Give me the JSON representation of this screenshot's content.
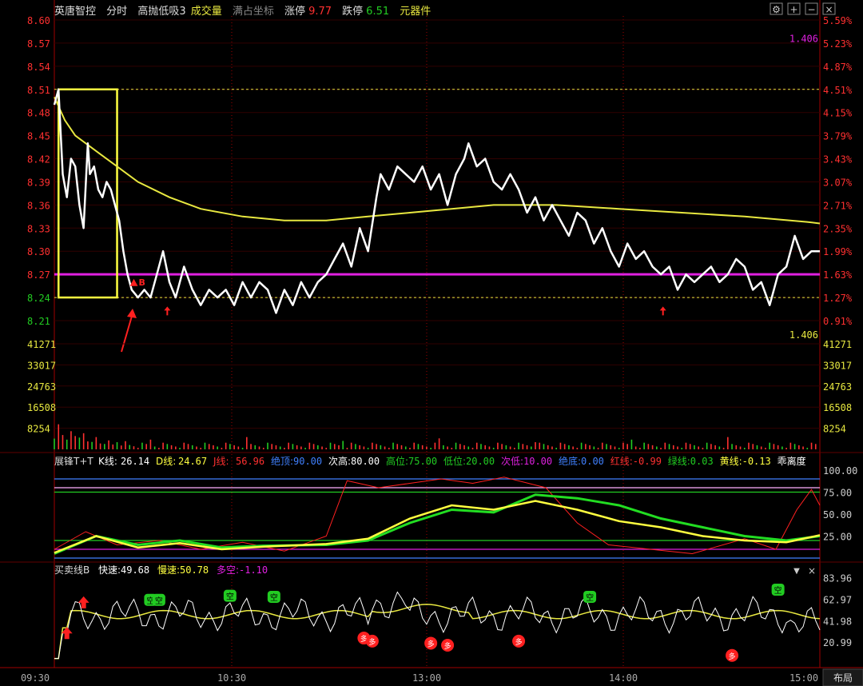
{
  "header": {
    "stock_name": "英唐智控",
    "view": "分时",
    "indicator": "高抛低吸3",
    "volume_label": "成交量",
    "coord_label": "满占坐标",
    "limit_up_label": "涨停",
    "limit_up_value": "9.77",
    "limit_down_label": "跌停",
    "limit_down_value": "6.51",
    "sector": "元器件",
    "icons": [
      "settings-icon",
      "plus-icon",
      "minus-icon",
      "close-icon"
    ]
  },
  "colors": {
    "price_line": "#ffffff",
    "avg_line": "#e8e840",
    "support_line": "#e020e0",
    "box": "#ffff40",
    "up": "#ff2020",
    "down": "#22cc22",
    "grid": "#a00000"
  },
  "chart_data": [
    {
      "type": "line",
      "name": "intraday-price",
      "y_left_ticks": [
        "8.60",
        "8.57",
        "8.54",
        "8.51",
        "8.48",
        "8.45",
        "8.42",
        "8.39",
        "8.36",
        "8.33",
        "8.30",
        "8.27",
        "8.24",
        "8.21"
      ],
      "y_right_ticks": [
        "5.59%",
        "5.23%",
        "4.87%",
        "4.51%",
        "4.15%",
        "3.79%",
        "3.43%",
        "3.07%",
        "2.71%",
        "2.35%",
        "1.99%",
        "1.63%",
        "1.27%",
        "0.91%"
      ],
      "ylim": [
        8.21,
        8.6
      ],
      "x_ticks": [
        "09:30",
        "10:30",
        "13:00",
        "14:00",
        "15:00"
      ],
      "right_labels": [
        "1.406",
        "1.406"
      ],
      "support_level": 8.27,
      "box_range": {
        "price_high": 8.51,
        "price_low": 8.24,
        "time_start": 2,
        "time_end": 30
      },
      "price_points": [
        [
          0,
          8.49
        ],
        [
          2,
          8.51
        ],
        [
          4,
          8.4
        ],
        [
          6,
          8.37
        ],
        [
          8,
          8.42
        ],
        [
          10,
          8.41
        ],
        [
          12,
          8.36
        ],
        [
          14,
          8.33
        ],
        [
          16,
          8.44
        ],
        [
          17,
          8.4
        ],
        [
          19,
          8.41
        ],
        [
          21,
          8.38
        ],
        [
          23,
          8.37
        ],
        [
          25,
          8.39
        ],
        [
          27,
          8.38
        ],
        [
          29,
          8.36
        ],
        [
          31,
          8.34
        ],
        [
          33,
          8.3
        ],
        [
          35,
          8.27
        ],
        [
          37,
          8.25
        ],
        [
          40,
          8.24
        ],
        [
          43,
          8.25
        ],
        [
          46,
          8.24
        ],
        [
          49,
          8.27
        ],
        [
          52,
          8.3
        ],
        [
          55,
          8.26
        ],
        [
          58,
          8.24
        ],
        [
          62,
          8.28
        ],
        [
          66,
          8.25
        ],
        [
          70,
          8.23
        ],
        [
          74,
          8.25
        ],
        [
          78,
          8.24
        ],
        [
          82,
          8.25
        ],
        [
          86,
          8.23
        ],
        [
          90,
          8.26
        ],
        [
          94,
          8.24
        ],
        [
          98,
          8.26
        ],
        [
          102,
          8.25
        ],
        [
          106,
          8.22
        ],
        [
          110,
          8.25
        ],
        [
          114,
          8.23
        ],
        [
          118,
          8.26
        ],
        [
          122,
          8.24
        ],
        [
          126,
          8.26
        ],
        [
          130,
          8.27
        ],
        [
          134,
          8.29
        ],
        [
          138,
          8.31
        ],
        [
          142,
          8.28
        ],
        [
          146,
          8.33
        ],
        [
          150,
          8.3
        ],
        [
          154,
          8.37
        ],
        [
          156,
          8.4
        ],
        [
          160,
          8.38
        ],
        [
          164,
          8.41
        ],
        [
          168,
          8.4
        ],
        [
          172,
          8.39
        ],
        [
          176,
          8.41
        ],
        [
          180,
          8.38
        ],
        [
          184,
          8.4
        ],
        [
          188,
          8.36
        ],
        [
          192,
          8.4
        ],
        [
          196,
          8.42
        ],
        [
          198,
          8.44
        ],
        [
          202,
          8.41
        ],
        [
          206,
          8.42
        ],
        [
          210,
          8.39
        ],
        [
          214,
          8.38
        ],
        [
          218,
          8.4
        ],
        [
          222,
          8.38
        ],
        [
          226,
          8.35
        ],
        [
          230,
          8.37
        ],
        [
          234,
          8.34
        ],
        [
          238,
          8.36
        ],
        [
          242,
          8.34
        ],
        [
          246,
          8.32
        ],
        [
          250,
          8.35
        ],
        [
          254,
          8.34
        ],
        [
          258,
          8.31
        ],
        [
          262,
          8.33
        ],
        [
          266,
          8.3
        ],
        [
          270,
          8.28
        ],
        [
          274,
          8.31
        ],
        [
          278,
          8.29
        ],
        [
          282,
          8.3
        ],
        [
          286,
          8.28
        ],
        [
          290,
          8.27
        ],
        [
          294,
          8.28
        ],
        [
          298,
          8.25
        ],
        [
          302,
          8.27
        ],
        [
          306,
          8.26
        ],
        [
          310,
          8.27
        ],
        [
          314,
          8.28
        ],
        [
          318,
          8.26
        ],
        [
          322,
          8.27
        ],
        [
          326,
          8.29
        ],
        [
          330,
          8.28
        ],
        [
          334,
          8.25
        ],
        [
          338,
          8.26
        ],
        [
          342,
          8.23
        ],
        [
          346,
          8.27
        ],
        [
          350,
          8.28
        ],
        [
          354,
          8.32
        ],
        [
          358,
          8.29
        ],
        [
          362,
          8.3
        ],
        [
          366,
          8.3
        ]
      ],
      "avg_points": [
        [
          0,
          8.5
        ],
        [
          5,
          8.47
        ],
        [
          10,
          8.45
        ],
        [
          20,
          8.43
        ],
        [
          30,
          8.41
        ],
        [
          40,
          8.39
        ],
        [
          55,
          8.37
        ],
        [
          70,
          8.355
        ],
        [
          90,
          8.345
        ],
        [
          110,
          8.34
        ],
        [
          130,
          8.34
        ],
        [
          150,
          8.345
        ],
        [
          170,
          8.35
        ],
        [
          190,
          8.355
        ],
        [
          210,
          8.36
        ],
        [
          240,
          8.36
        ],
        [
          270,
          8.355
        ],
        [
          300,
          8.35
        ],
        [
          330,
          8.345
        ],
        [
          360,
          8.338
        ],
        [
          366,
          8.336
        ]
      ],
      "up_arrows": [
        [
          54,
          8.22
        ],
        [
          291,
          8.22
        ]
      ],
      "buy_marker": {
        "t": 38,
        "price": 8.26,
        "label": "B"
      }
    },
    {
      "type": "bar",
      "name": "volume",
      "y_ticks": [
        "41271",
        "33017",
        "24763",
        "16508",
        "8254"
      ],
      "ylim": [
        0,
        41271
      ],
      "series": [
        {
          "name": "成交量",
          "values": [
            4200,
            9800,
            5600,
            3800,
            7100,
            5200,
            4600,
            6300,
            3100,
            2900,
            4800,
            2300,
            2100,
            3500,
            1900,
            2800,
            1500,
            3200,
            1700,
            1200
          ]
        }
      ]
    },
    {
      "type": "line",
      "name": "kdj-oscillator",
      "title": "展锋T+T",
      "legend": [
        {
          "key": "K线",
          "value": "26.14",
          "color": "#ffffff"
        },
        {
          "key": "D线",
          "value": "24.67",
          "color": "#ffff40"
        },
        {
          "key": "J线",
          "value": "56.96",
          "color": "#ff3030"
        },
        {
          "key": "绝顶",
          "value": "90.00",
          "color": "#4080ff"
        },
        {
          "key": "次高",
          "value": "80.00",
          "color": "#ffffff"
        },
        {
          "key": "高位",
          "value": "75.00",
          "color": "#22cc22"
        },
        {
          "key": "低位",
          "value": "20.00",
          "color": "#22cc22"
        },
        {
          "key": "次低",
          "value": "10.00",
          "color": "#e020e0"
        },
        {
          "key": "绝底",
          "value": "0.00",
          "color": "#4080ff"
        },
        {
          "key": "红线",
          "value": "-0.99",
          "color": "#ff3030"
        },
        {
          "key": "绿线",
          "value": "0.03",
          "color": "#22cc22"
        },
        {
          "key": "黄线",
          "value": "-0.13",
          "color": "#ffff40"
        },
        {
          "key": "乖离度",
          "value": "",
          "color": "#ffffff"
        }
      ],
      "y_ticks": [
        "100.00",
        "75.00",
        "50.00",
        "25.00"
      ],
      "ylim": [
        0,
        100
      ],
      "levels": [
        90,
        80,
        75,
        20,
        10,
        0
      ],
      "green": [
        [
          0,
          5
        ],
        [
          20,
          25
        ],
        [
          40,
          15
        ],
        [
          60,
          20
        ],
        [
          80,
          12
        ],
        [
          100,
          14
        ],
        [
          130,
          15
        ],
        [
          150,
          20
        ],
        [
          170,
          40
        ],
        [
          190,
          55
        ],
        [
          210,
          52
        ],
        [
          230,
          72
        ],
        [
          250,
          68
        ],
        [
          270,
          60
        ],
        [
          290,
          45
        ],
        [
          310,
          35
        ],
        [
          330,
          25
        ],
        [
          350,
          20
        ],
        [
          366,
          25
        ]
      ],
      "yellow": [
        [
          0,
          6
        ],
        [
          20,
          25
        ],
        [
          40,
          12
        ],
        [
          60,
          17
        ],
        [
          80,
          10
        ],
        [
          100,
          13
        ],
        [
          130,
          16
        ],
        [
          150,
          22
        ],
        [
          170,
          45
        ],
        [
          190,
          60
        ],
        [
          210,
          55
        ],
        [
          230,
          65
        ],
        [
          250,
          55
        ],
        [
          270,
          42
        ],
        [
          290,
          35
        ],
        [
          310,
          25
        ],
        [
          330,
          20
        ],
        [
          350,
          18
        ],
        [
          366,
          26
        ]
      ],
      "red": [
        [
          0,
          10
        ],
        [
          15,
          30
        ],
        [
          30,
          15
        ],
        [
          50,
          20
        ],
        [
          70,
          10
        ],
        [
          90,
          18
        ],
        [
          110,
          8
        ],
        [
          130,
          25
        ],
        [
          140,
          88
        ],
        [
          155,
          80
        ],
        [
          170,
          85
        ],
        [
          185,
          90
        ],
        [
          200,
          85
        ],
        [
          215,
          92
        ],
        [
          235,
          80
        ],
        [
          250,
          40
        ],
        [
          265,
          15
        ],
        [
          285,
          10
        ],
        [
          305,
          5
        ],
        [
          330,
          22
        ],
        [
          345,
          10
        ],
        [
          355,
          55
        ],
        [
          362,
          78
        ],
        [
          366,
          60
        ]
      ]
    },
    {
      "type": "line",
      "name": "buy-sell-line",
      "title": "买卖线B",
      "legend": [
        {
          "key": "快速",
          "value": "49.68",
          "color": "#ffffff"
        },
        {
          "key": "慢速",
          "value": "50.78",
          "color": "#ffff40"
        },
        {
          "key": "多空",
          "value": "-1.10",
          "color": "#e020e0"
        }
      ],
      "y_ticks": [
        "83.96",
        "62.97",
        "41.98",
        "20.99"
      ],
      "ylim": [
        0,
        90
      ],
      "markers_kong": [
        "空",
        "空",
        "空",
        "空",
        "空",
        "空"
      ],
      "markers_duo": [
        "多",
        "多",
        "多",
        "多",
        "多",
        "多"
      ],
      "up_arrow_marks": 2
    }
  ],
  "footer": {
    "layout_button": "布局"
  }
}
